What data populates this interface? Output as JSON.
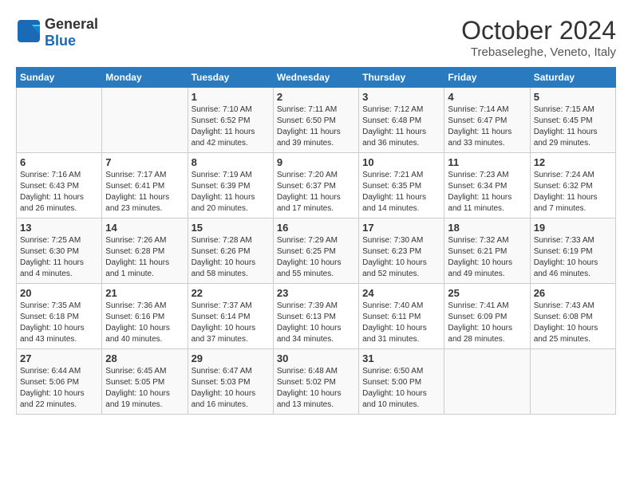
{
  "header": {
    "logo_general": "General",
    "logo_blue": "Blue",
    "month_title": "October 2024",
    "location": "Trebaseleghe, Veneto, Italy"
  },
  "weekdays": [
    "Sunday",
    "Monday",
    "Tuesday",
    "Wednesday",
    "Thursday",
    "Friday",
    "Saturday"
  ],
  "weeks": [
    [
      {
        "day": "",
        "details": ""
      },
      {
        "day": "",
        "details": ""
      },
      {
        "day": "1",
        "details": "Sunrise: 7:10 AM\nSunset: 6:52 PM\nDaylight: 11 hours and 42 minutes."
      },
      {
        "day": "2",
        "details": "Sunrise: 7:11 AM\nSunset: 6:50 PM\nDaylight: 11 hours and 39 minutes."
      },
      {
        "day": "3",
        "details": "Sunrise: 7:12 AM\nSunset: 6:48 PM\nDaylight: 11 hours and 36 minutes."
      },
      {
        "day": "4",
        "details": "Sunrise: 7:14 AM\nSunset: 6:47 PM\nDaylight: 11 hours and 33 minutes."
      },
      {
        "day": "5",
        "details": "Sunrise: 7:15 AM\nSunset: 6:45 PM\nDaylight: 11 hours and 29 minutes."
      }
    ],
    [
      {
        "day": "6",
        "details": "Sunrise: 7:16 AM\nSunset: 6:43 PM\nDaylight: 11 hours and 26 minutes."
      },
      {
        "day": "7",
        "details": "Sunrise: 7:17 AM\nSunset: 6:41 PM\nDaylight: 11 hours and 23 minutes."
      },
      {
        "day": "8",
        "details": "Sunrise: 7:19 AM\nSunset: 6:39 PM\nDaylight: 11 hours and 20 minutes."
      },
      {
        "day": "9",
        "details": "Sunrise: 7:20 AM\nSunset: 6:37 PM\nDaylight: 11 hours and 17 minutes."
      },
      {
        "day": "10",
        "details": "Sunrise: 7:21 AM\nSunset: 6:35 PM\nDaylight: 11 hours and 14 minutes."
      },
      {
        "day": "11",
        "details": "Sunrise: 7:23 AM\nSunset: 6:34 PM\nDaylight: 11 hours and 11 minutes."
      },
      {
        "day": "12",
        "details": "Sunrise: 7:24 AM\nSunset: 6:32 PM\nDaylight: 11 hours and 7 minutes."
      }
    ],
    [
      {
        "day": "13",
        "details": "Sunrise: 7:25 AM\nSunset: 6:30 PM\nDaylight: 11 hours and 4 minutes."
      },
      {
        "day": "14",
        "details": "Sunrise: 7:26 AM\nSunset: 6:28 PM\nDaylight: 11 hours and 1 minute."
      },
      {
        "day": "15",
        "details": "Sunrise: 7:28 AM\nSunset: 6:26 PM\nDaylight: 10 hours and 58 minutes."
      },
      {
        "day": "16",
        "details": "Sunrise: 7:29 AM\nSunset: 6:25 PM\nDaylight: 10 hours and 55 minutes."
      },
      {
        "day": "17",
        "details": "Sunrise: 7:30 AM\nSunset: 6:23 PM\nDaylight: 10 hours and 52 minutes."
      },
      {
        "day": "18",
        "details": "Sunrise: 7:32 AM\nSunset: 6:21 PM\nDaylight: 10 hours and 49 minutes."
      },
      {
        "day": "19",
        "details": "Sunrise: 7:33 AM\nSunset: 6:19 PM\nDaylight: 10 hours and 46 minutes."
      }
    ],
    [
      {
        "day": "20",
        "details": "Sunrise: 7:35 AM\nSunset: 6:18 PM\nDaylight: 10 hours and 43 minutes."
      },
      {
        "day": "21",
        "details": "Sunrise: 7:36 AM\nSunset: 6:16 PM\nDaylight: 10 hours and 40 minutes."
      },
      {
        "day": "22",
        "details": "Sunrise: 7:37 AM\nSunset: 6:14 PM\nDaylight: 10 hours and 37 minutes."
      },
      {
        "day": "23",
        "details": "Sunrise: 7:39 AM\nSunset: 6:13 PM\nDaylight: 10 hours and 34 minutes."
      },
      {
        "day": "24",
        "details": "Sunrise: 7:40 AM\nSunset: 6:11 PM\nDaylight: 10 hours and 31 minutes."
      },
      {
        "day": "25",
        "details": "Sunrise: 7:41 AM\nSunset: 6:09 PM\nDaylight: 10 hours and 28 minutes."
      },
      {
        "day": "26",
        "details": "Sunrise: 7:43 AM\nSunset: 6:08 PM\nDaylight: 10 hours and 25 minutes."
      }
    ],
    [
      {
        "day": "27",
        "details": "Sunrise: 6:44 AM\nSunset: 5:06 PM\nDaylight: 10 hours and 22 minutes."
      },
      {
        "day": "28",
        "details": "Sunrise: 6:45 AM\nSunset: 5:05 PM\nDaylight: 10 hours and 19 minutes."
      },
      {
        "day": "29",
        "details": "Sunrise: 6:47 AM\nSunset: 5:03 PM\nDaylight: 10 hours and 16 minutes."
      },
      {
        "day": "30",
        "details": "Sunrise: 6:48 AM\nSunset: 5:02 PM\nDaylight: 10 hours and 13 minutes."
      },
      {
        "day": "31",
        "details": "Sunrise: 6:50 AM\nSunset: 5:00 PM\nDaylight: 10 hours and 10 minutes."
      },
      {
        "day": "",
        "details": ""
      },
      {
        "day": "",
        "details": ""
      }
    ]
  ]
}
